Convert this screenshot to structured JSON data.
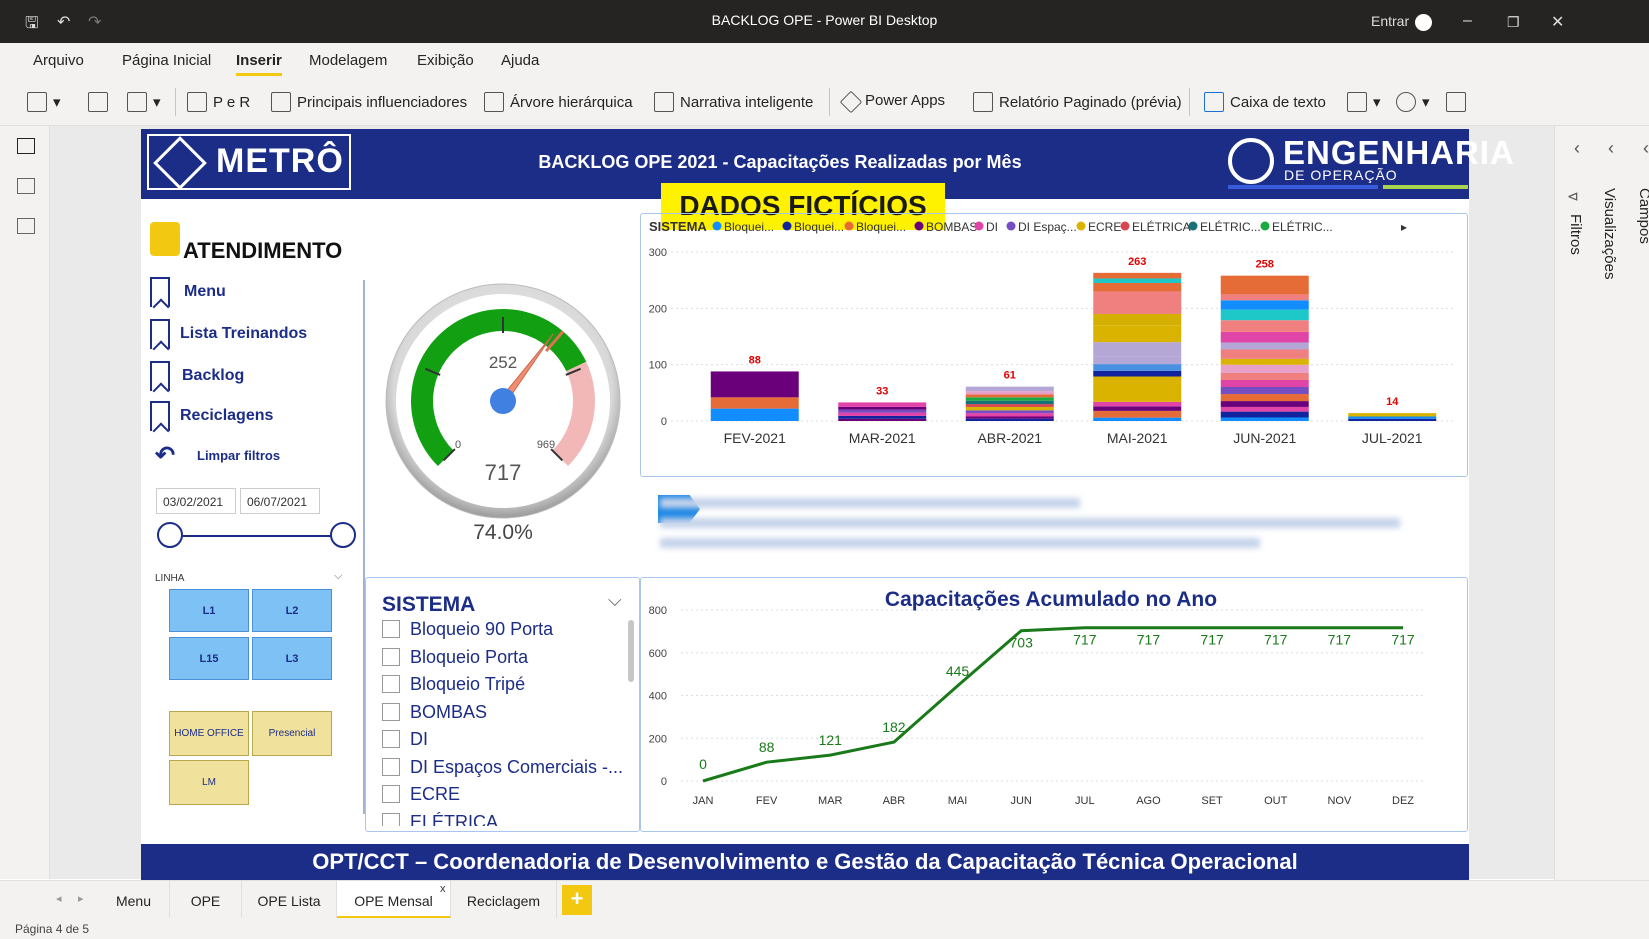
{
  "window": {
    "title": "BACKLOG OPE - Power BI Desktop",
    "signin": "Entrar"
  },
  "menu": [
    "Arquivo",
    "Página Inicial",
    "Inserir",
    "Modelagem",
    "Exibição",
    "Ajuda"
  ],
  "ribbon": {
    "qa": "P e R",
    "influencers": "Principais influenciadores",
    "tree": "Árvore hierárquica",
    "narrative": "Narrativa inteligente",
    "powerapps": "Power Apps",
    "paginated": "Relatório Paginado (prévia)",
    "textbox": "Caixa de texto"
  },
  "rightpanes": {
    "filters": "Filtros",
    "visuals": "Visualizações",
    "fields": "Campos"
  },
  "report": {
    "logo": "METRÔ",
    "title": "BACKLOG OPE 2021 - Capacitações Realizadas por Mês",
    "eng_title": "ENGENHARIA",
    "eng_sub": "DE OPERAÇÃO",
    "fict": "DADOS FICTÍCIOS",
    "section": "ATENDIMENTO",
    "nav": [
      "Menu",
      "Lista Treinandos",
      "Backlog",
      "Reciclagens"
    ],
    "clear": "Limpar filtros",
    "date_from": "03/02/2021",
    "date_to": "06/07/2021",
    "linha_label": "LINHA",
    "linha_buttons": [
      "L1",
      "L2",
      "L15",
      "L3"
    ],
    "mode_buttons": [
      "HOME OFFICE",
      "Presencial",
      "LM"
    ],
    "gauge": {
      "value": 717,
      "min": 0,
      "max": 969,
      "target": 252,
      "percent": "74.0%",
      "tick_min": "0",
      "tick_max": "969",
      "target_label": "252",
      "value_label": "717"
    },
    "sistema_title": "SISTEMA",
    "sistema_items": [
      "Bloqueio 90 Porta",
      "Bloqueio Porta",
      "Bloqueio Tripé",
      "BOMBAS",
      "DI",
      "DI Espaços Comerciais -...",
      "ECRE",
      "ELÉTRICA"
    ],
    "footer": "OPT/CCT – Coordenadoria de Desenvolvimento e Gestão da Capacitação Técnica Operacional"
  },
  "chart_data": [
    {
      "type": "bar",
      "stacked": true,
      "categories": [
        "FEV-2021",
        "MAR-2021",
        "ABR-2021",
        "MAI-2021",
        "JUN-2021",
        "JUL-2021"
      ],
      "totals": [
        88,
        33,
        61,
        263,
        258,
        14
      ],
      "legend_title": "SISTEMA",
      "legend": [
        {
          "name": "Bloquei...",
          "color": "#118dff"
        },
        {
          "name": "Bloquei...",
          "color": "#12239e"
        },
        {
          "name": "Bloquei...",
          "color": "#e66c37"
        },
        {
          "name": "BOMBAS",
          "color": "#6b007b"
        },
        {
          "name": "DI",
          "color": "#e044a7"
        },
        {
          "name": "DI Espaç...",
          "color": "#744ec2"
        },
        {
          "name": "ECRE",
          "color": "#d9b300"
        },
        {
          "name": "ELÉTRICA",
          "color": "#d64550"
        },
        {
          "name": "ELÉTRIC...",
          "color": "#197278"
        },
        {
          "name": "ELÉTRIC...",
          "color": "#1aab40"
        }
      ],
      "y_ticks": [
        0,
        100,
        200,
        300
      ],
      "ylim": [
        0,
        300
      ],
      "segments": [
        [
          {
            "v": 22,
            "c": "#118dff"
          },
          {
            "v": 20,
            "c": "#e66c37"
          },
          {
            "v": 46,
            "c": "#6b007b"
          }
        ],
        [
          {
            "v": 4,
            "c": "#6b007b"
          },
          {
            "v": 5,
            "c": "#12239e"
          },
          {
            "v": 6,
            "c": "#e044a7"
          },
          {
            "v": 5,
            "c": "#744ec2"
          },
          {
            "v": 5,
            "c": "#6b007b"
          },
          {
            "v": 8,
            "c": "#e044a7"
          }
        ],
        [
          {
            "v": 4,
            "c": "#12239e"
          },
          {
            "v": 4,
            "c": "#6b007b"
          },
          {
            "v": 6,
            "c": "#e044a7"
          },
          {
            "v": 5,
            "c": "#744ec2"
          },
          {
            "v": 6,
            "c": "#d9b300"
          },
          {
            "v": 5,
            "c": "#d64550"
          },
          {
            "v": 6,
            "c": "#197278"
          },
          {
            "v": 6,
            "c": "#1aab40"
          },
          {
            "v": 5,
            "c": "#e66c37"
          },
          {
            "v": 6,
            "c": "#e8a0c8"
          },
          {
            "v": 8,
            "c": "#b4a7d6"
          }
        ],
        [
          {
            "v": 6,
            "c": "#118dff"
          },
          {
            "v": 12,
            "c": "#e66c37"
          },
          {
            "v": 8,
            "c": "#6b007b"
          },
          {
            "v": 8,
            "c": "#e044a7"
          },
          {
            "v": 45,
            "c": "#d9b300"
          },
          {
            "v": 10,
            "c": "#12239e"
          },
          {
            "v": 12,
            "c": "#4a90e2"
          },
          {
            "v": 14,
            "c": "#b4a7d6"
          },
          {
            "v": 25,
            "c": "#b4a7d6"
          },
          {
            "v": 30,
            "c": "#d9b300"
          },
          {
            "v": 20,
            "c": "#d4b100"
          },
          {
            "v": 40,
            "c": "#f08080"
          },
          {
            "v": 15,
            "c": "#e66c37"
          },
          {
            "v": 8,
            "c": "#1ec8c8"
          },
          {
            "v": 10,
            "c": "#e66c37"
          }
        ],
        [
          {
            "v": 6,
            "c": "#118dff"
          },
          {
            "v": 10,
            "c": "#12239e"
          },
          {
            "v": 8,
            "c": "#e044a7"
          },
          {
            "v": 10,
            "c": "#6b007b"
          },
          {
            "v": 12,
            "c": "#e66c37"
          },
          {
            "v": 12,
            "c": "#744ec2"
          },
          {
            "v": 12,
            "c": "#e044a7"
          },
          {
            "v": 12,
            "c": "#f08080"
          },
          {
            "v": 14,
            "c": "#e8a0c8"
          },
          {
            "v": 10,
            "c": "#d9b300"
          },
          {
            "v": 16,
            "c": "#f08080"
          },
          {
            "v": 12,
            "c": "#b4a7d6"
          },
          {
            "v": 18,
            "c": "#e044a7"
          },
          {
            "v": 20,
            "c": "#f08080"
          },
          {
            "v": 18,
            "c": "#1ec8c8"
          },
          {
            "v": 16,
            "c": "#118dff"
          },
          {
            "v": 10,
            "c": "#f08080"
          },
          {
            "v": 32,
            "c": "#e66c37"
          }
        ],
        [
          {
            "v": 4,
            "c": "#12239e"
          },
          {
            "v": 4,
            "c": "#118dff"
          },
          {
            "v": 6,
            "c": "#d9b300"
          }
        ]
      ]
    },
    {
      "type": "line",
      "title": "Capacitações Acumulado no Ano",
      "x": [
        "JAN",
        "FEV",
        "MAR",
        "ABR",
        "MAI",
        "JUN",
        "JUL",
        "AGO",
        "SET",
        "OUT",
        "NOV",
        "DEZ"
      ],
      "y": [
        0,
        88,
        121,
        182,
        445,
        703,
        717,
        717,
        717,
        717,
        717,
        717
      ],
      "y_ticks": [
        0,
        200,
        400,
        600,
        800
      ],
      "ylim": [
        0,
        800
      ],
      "color": "#1a7a1a"
    }
  ],
  "tabs": [
    "Menu",
    "OPE",
    "OPE Lista",
    "OPE Mensal",
    "Reciclagem"
  ],
  "active_tab": "OPE Mensal",
  "status": "Página 4 de 5"
}
